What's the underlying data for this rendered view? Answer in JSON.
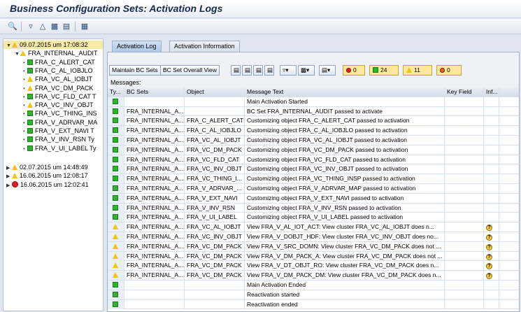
{
  "window": {
    "title": "Business Configuration Sets: Activation Logs"
  },
  "toolbar": {
    "icons": [
      "find-icon",
      "filter-icon",
      "sort-icon",
      "print-icon",
      "export-icon",
      "layout-icon"
    ]
  },
  "tree": {
    "nodes": [
      {
        "label": "09.07.2015 um 17:08:32",
        "status": "warning",
        "level": 0,
        "expanded": true,
        "selected": true
      },
      {
        "label": "FRA_INTERNAL_AUDIT",
        "status": "warning",
        "level": 1,
        "expanded": true
      },
      {
        "label": "FRA_C_ALERT_CAT",
        "status": "success",
        "level": 2
      },
      {
        "label": "FRA_C_AL_IOBJLO",
        "status": "success",
        "level": 2
      },
      {
        "label": "FRA_VC_AL_IOBJT",
        "status": "warning",
        "level": 2
      },
      {
        "label": "FRA_VC_DM_PACK",
        "status": "warning",
        "level": 2
      },
      {
        "label": "FRA_VC_FLD_CAT T",
        "status": "success",
        "level": 2
      },
      {
        "label": "FRA_VC_INV_OBJT",
        "status": "warning",
        "level": 2
      },
      {
        "label": "FRA_VC_THING_INS",
        "status": "success",
        "level": 2
      },
      {
        "label": "FRA_V_ADRVAR_MA",
        "status": "success",
        "level": 2
      },
      {
        "label": "FRA_V_EXT_NAVI T",
        "status": "success",
        "level": 2
      },
      {
        "label": "FRA_V_INV_RSN Ty",
        "status": "success",
        "level": 2
      },
      {
        "label": "FRA_V_UI_LABEL Ty",
        "status": "success",
        "level": 2
      },
      {
        "label": "02.07.2015 um 14:48:49",
        "status": "warning",
        "level": 0
      },
      {
        "label": "16.06.2015 um 12:08:17",
        "status": "warning",
        "level": 0
      },
      {
        "label": "16.06.2015 um 12:02:41",
        "status": "error",
        "level": 0
      }
    ]
  },
  "tabs": [
    {
      "label": "Activation Log",
      "active": true
    },
    {
      "label": "Activation Information",
      "active": false
    }
  ],
  "actions": {
    "maintain": "Maintain BC Sets",
    "overall": "BC Set Overall View",
    "count_errors": "0",
    "count_success": "24",
    "count_warnings": "11",
    "count_info": "0"
  },
  "messages_label": "Messages:",
  "grid": {
    "headers": {
      "type": "Ty...",
      "bcset": "BC Sets",
      "object": "Object",
      "text": "Message Text",
      "key": "Key Field",
      "info": "Inf..."
    },
    "rows": [
      {
        "status": "success",
        "bcset": "",
        "object": "",
        "text": "Main Activation Started",
        "info": false
      },
      {
        "status": "success",
        "bcset": "FRA_INTERNAL_A...",
        "object": "",
        "text": "BC Set FRA_INTERNAL_AUDIT passed to activate",
        "info": false
      },
      {
        "status": "success",
        "bcset": "FRA_INTERNAL_A...",
        "object": "FRA_C_ALERT_CAT",
        "text": "Customizing object FRA_C_ALERT_CAT passed to activation",
        "info": false
      },
      {
        "status": "success",
        "bcset": "FRA_INTERNAL_A...",
        "object": "FRA_C_AL_IOBJLO",
        "text": "Customizing object FRA_C_AL_IOBJLO passed to activation",
        "info": false
      },
      {
        "status": "success",
        "bcset": "FRA_INTERNAL_A...",
        "object": "FRA_VC_AL_IOBJT",
        "text": "Customizing object FRA_VC_AL_IOBJT passed to activation",
        "info": false
      },
      {
        "status": "success",
        "bcset": "FRA_INTERNAL_A...",
        "object": "FRA_VC_DM_PACK",
        "text": "Customizing object FRA_VC_DM_PACK passed to activation",
        "info": false
      },
      {
        "status": "success",
        "bcset": "FRA_INTERNAL_A...",
        "object": "FRA_VC_FLD_CAT",
        "text": "Customizing object FRA_VC_FLD_CAT passed to activation",
        "info": false
      },
      {
        "status": "success",
        "bcset": "FRA_INTERNAL_A...",
        "object": "FRA_VC_INV_OBJT",
        "text": "Customizing object FRA_VC_INV_OBJT passed to activation",
        "info": false
      },
      {
        "status": "success",
        "bcset": "FRA_INTERNAL_A...",
        "object": "FRA_VC_THING_I...",
        "text": "Customizing object FRA_VC_THING_INSP passed to activation",
        "info": false
      },
      {
        "status": "success",
        "bcset": "FRA_INTERNAL_A...",
        "object": "FRA_V_ADRVAR_...",
        "text": "Customizing object FRA_V_ADRVAR_MAP passed to activation",
        "info": false
      },
      {
        "status": "success",
        "bcset": "FRA_INTERNAL_A...",
        "object": "FRA_V_EXT_NAVI",
        "text": "Customizing object FRA_V_EXT_NAVI passed to activation",
        "info": false
      },
      {
        "status": "success",
        "bcset": "FRA_INTERNAL_A...",
        "object": "FRA_V_INV_RSN",
        "text": "Customizing object FRA_V_INV_RSN passed to activation",
        "info": false
      },
      {
        "status": "success",
        "bcset": "FRA_INTERNAL_A...",
        "object": "FRA_V_UI_LABEL",
        "text": "Customizing object FRA_V_UI_LABEL passed to activation",
        "info": false
      },
      {
        "status": "warning",
        "bcset": "FRA_INTERNAL_A...",
        "object": "FRA_VC_AL_IOBJT",
        "text": "View FRA_V_AL_IOT_ACT: View cluster FRA_VC_AL_IOBJT does n...",
        "info": true
      },
      {
        "status": "warning",
        "bcset": "FRA_INTERNAL_A...",
        "object": "FRA_VC_INV_OBJT",
        "text": "View FRA_V_DOBJT_HDF: View cluster FRA_VC_INV_OBJT does no...",
        "info": true
      },
      {
        "status": "warning",
        "bcset": "FRA_INTERNAL_A...",
        "object": "FRA_VC_DM_PACK",
        "text": "View FRA_V_SRC_DOMN: View cluster FRA_VC_DM_PACK does not ...",
        "info": true
      },
      {
        "status": "warning",
        "bcset": "FRA_INTERNAL_A...",
        "object": "FRA_VC_DM_PACK",
        "text": "View FRA_V_DM_PACK_A: View cluster FRA_VC_DM_PACK does not ...",
        "info": true
      },
      {
        "status": "warning",
        "bcset": "FRA_INTERNAL_A...",
        "object": "FRA_VC_DM_PACK",
        "text": "View FRA_V_DT_OBJT_RO: View cluster FRA_VC_DM_PACK does n...",
        "info": true
      },
      {
        "status": "warning",
        "bcset": "FRA_INTERNAL_A...",
        "object": "FRA_VC_DM_PACK",
        "text": "View FRA_V_DM_PACK_DM: View cluster FRA_VC_DM_PACK does n...",
        "info": true
      },
      {
        "status": "success",
        "bcset": "",
        "object": "",
        "text": "Main Activation Ended",
        "info": false
      },
      {
        "status": "success",
        "bcset": "",
        "object": "",
        "text": "Reactivation started",
        "info": false
      },
      {
        "status": "success",
        "bcset": "",
        "object": "",
        "text": "Reactivation ended",
        "info": false
      }
    ]
  },
  "colors": {
    "success": "#2bb52b",
    "warning": "#f1c40f",
    "error": "#e02020",
    "selected": "#f7e9a6"
  }
}
